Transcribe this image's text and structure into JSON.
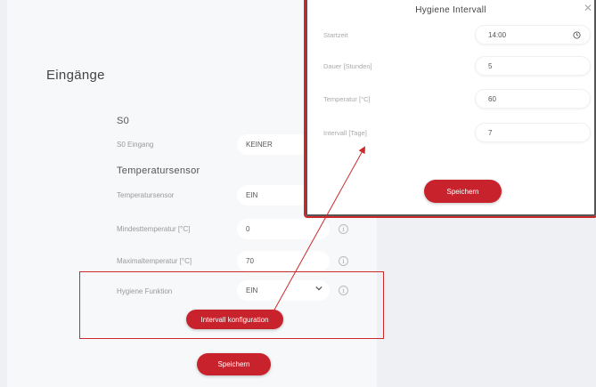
{
  "page": {
    "section_title": "Eingänge",
    "s0": {
      "group_title": "S0",
      "input_label": "S0 Eingang",
      "input_value": "KEINER"
    },
    "temp_sensor": {
      "group_title": "Temperatursensor",
      "sensor_label": "Temperatursensor",
      "sensor_value": "EIN",
      "min_label": "Mindesttemperatur [°C]",
      "min_value": "0",
      "max_label": "Maximaltemperatur [°C]",
      "max_value": "70"
    },
    "hygiene": {
      "label": "Hygiene Funktion",
      "value": "EIN",
      "config_button": "Intervall konfiguration"
    },
    "save_button": "Speichern",
    "info_glyph": "i"
  },
  "modal": {
    "title": "Hygiene Intervall",
    "close_glyph": "✕",
    "start_label": "Startzeit",
    "start_value": "14:00",
    "duration_label": "Dauer [Stunden]",
    "duration_value": "5",
    "temperature_label": "Temperatur [°C]",
    "temperature_value": "60",
    "interval_label": "Intervall [Tage]",
    "interval_value": "7",
    "save_button": "Speichern"
  },
  "colors": {
    "accent": "#c8232c",
    "highlight": "#cc2a2a"
  }
}
